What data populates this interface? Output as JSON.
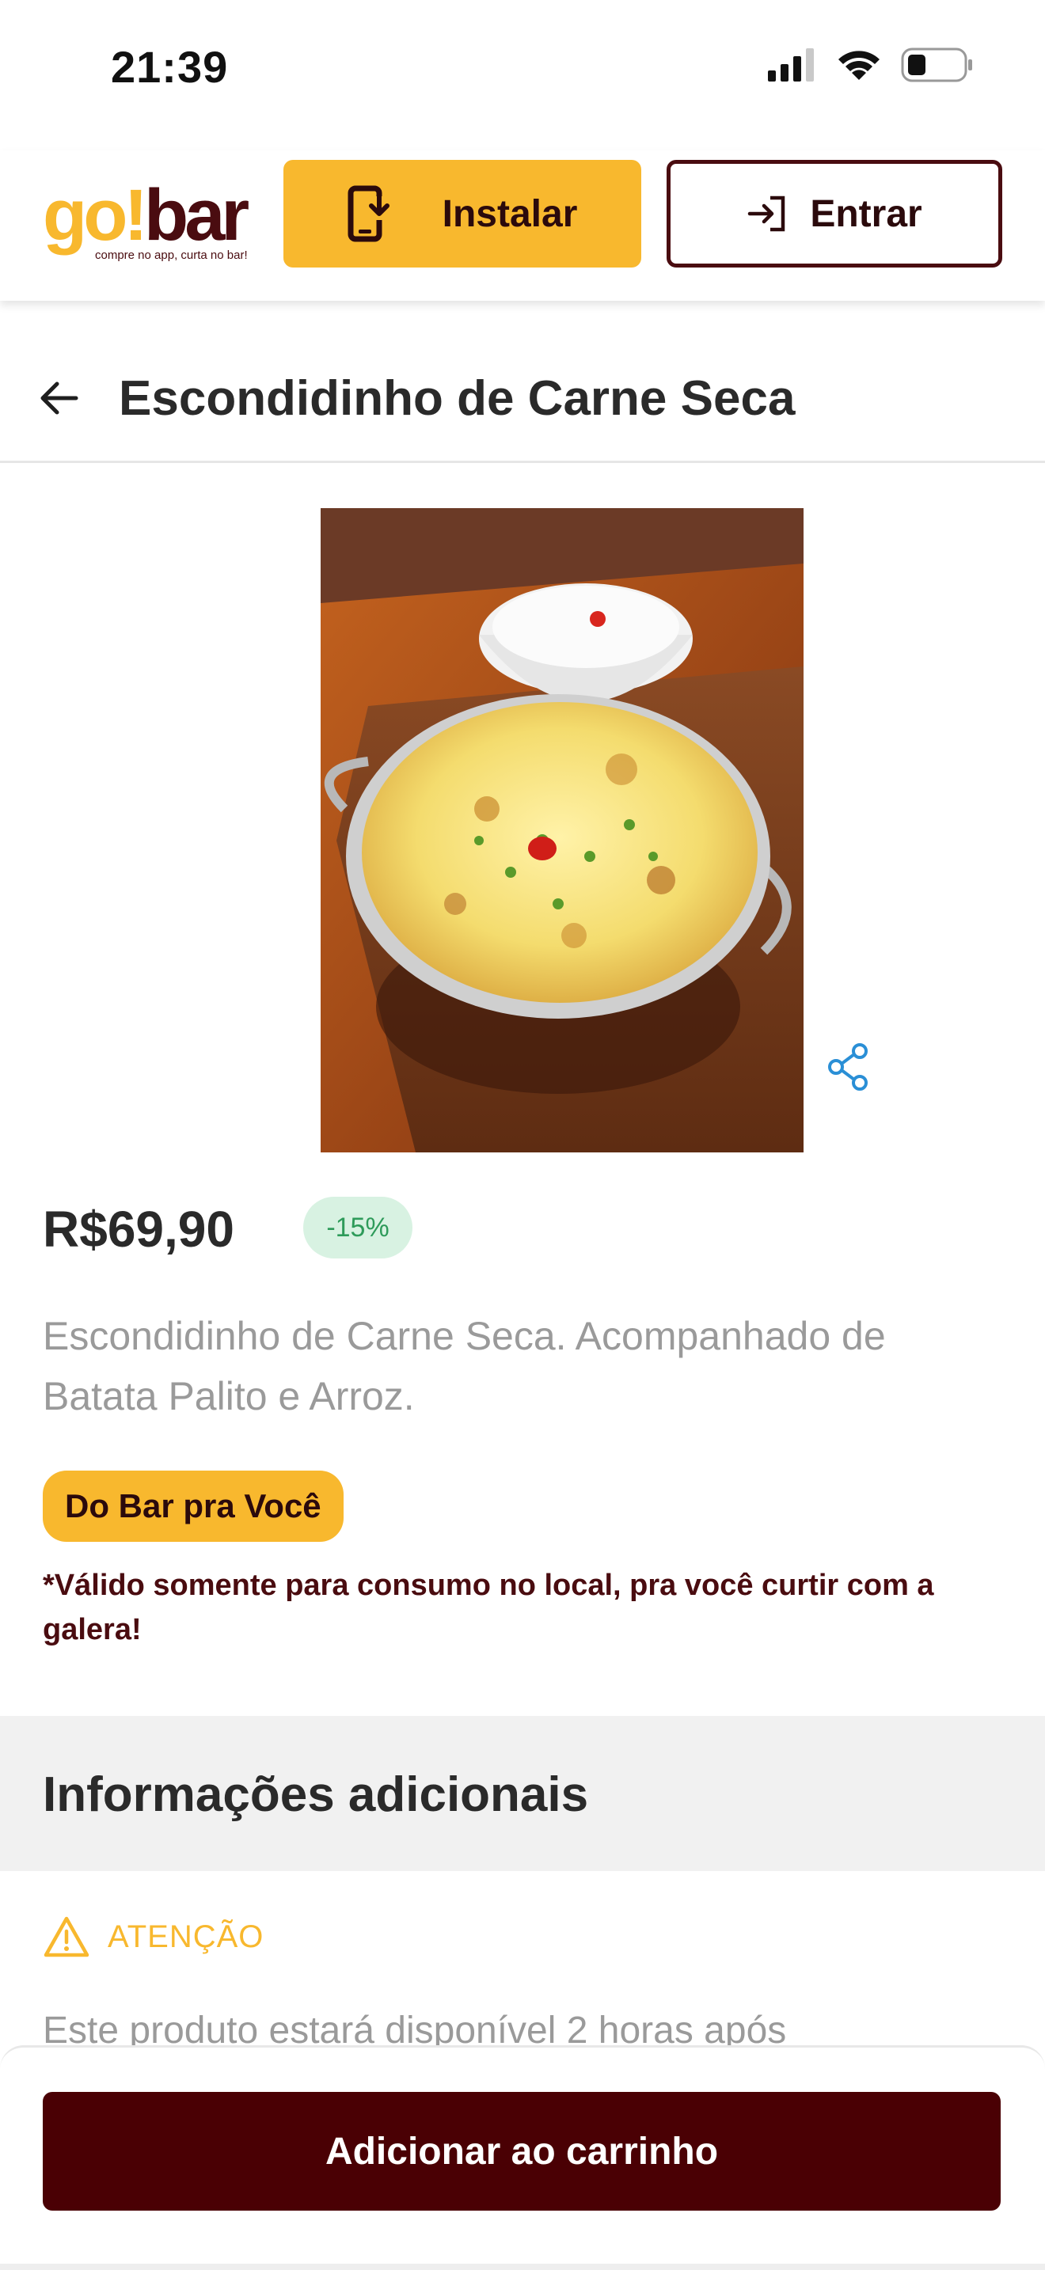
{
  "status_bar": {
    "time": "21:39",
    "icons": [
      "cellular-signal-icon",
      "wifi-icon",
      "battery-icon"
    ]
  },
  "header": {
    "logo_text_go": "go",
    "logo_text_bang": "!",
    "logo_text_bar": "bar",
    "logo_tagline": "compre no app, curta no bar!",
    "install_label": "Instalar",
    "install_icon": "phone-download-icon",
    "enter_label": "Entrar",
    "enter_icon": "sign-in-icon"
  },
  "page": {
    "title": "Escondidinho de Carne Seca",
    "back_icon": "arrow-left-icon"
  },
  "product": {
    "price": "R$69,90",
    "discount": "-15%",
    "description": "Escondidinho de Carne Seca. Acompanhado de Batata Palito e Arroz.",
    "tag": "Do Bar pra Você",
    "note": "*Válido somente para consumo no local, pra você curtir com a galera!",
    "share_icon": "share-icon"
  },
  "info": {
    "title": "Informações adicionais",
    "attention_label": "ATENÇÃO",
    "attention_text": "Este produto estará disponível 2 horas após"
  },
  "bottom": {
    "cart_label": "Adicionar ao carrinho"
  },
  "colors": {
    "brand_yellow": "#f8b82e",
    "brand_maroon": "#4a0c10",
    "cart_button": "#4a0004",
    "discount_bg": "#d8f2e2",
    "discount_text": "#2e9b5a"
  }
}
